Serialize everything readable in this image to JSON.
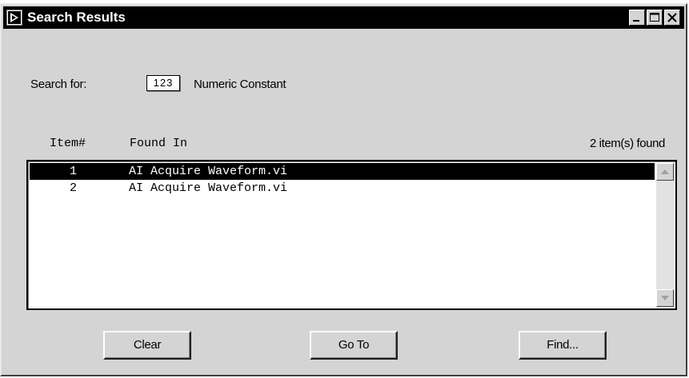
{
  "window": {
    "title": "Search Results"
  },
  "search": {
    "label": "Search for:",
    "constant_value": "123",
    "constant_type": "Numeric Constant"
  },
  "columns": {
    "item": "Item#",
    "found_in": "Found In"
  },
  "results_count": "2 item(s) found",
  "results": [
    {
      "num": "1",
      "path": "AI Acquire Waveform.vi",
      "selected": true
    },
    {
      "num": "2",
      "path": "AI Acquire Waveform.vi",
      "selected": false
    }
  ],
  "buttons": {
    "clear": "Clear",
    "goto": "Go To",
    "find": "Find..."
  },
  "icons": {
    "app": "labview-vi-icon",
    "minimize": "minimize-icon",
    "maximize": "maximize-icon",
    "close": "close-icon",
    "scroll_up": "scroll-up-arrow-icon",
    "scroll_down": "scroll-down-arrow-icon"
  },
  "colors": {
    "titlebar": "#000000",
    "selection": "#000000",
    "window_bg": "#d4d4d4"
  }
}
